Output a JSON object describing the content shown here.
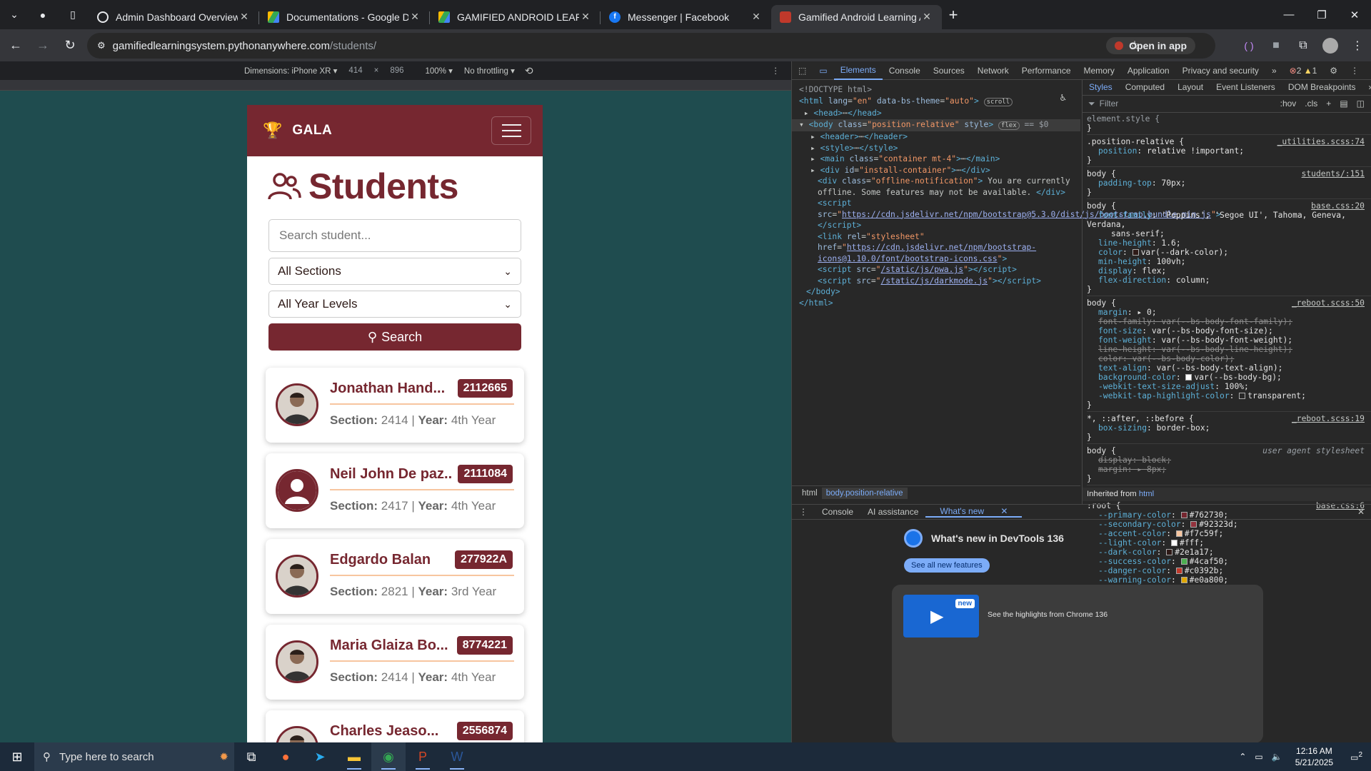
{
  "browser": {
    "tabs": [
      {
        "title": "Admin Dashboard Overview",
        "active": false
      },
      {
        "title": "Documentations - Google Drive",
        "active": false
      },
      {
        "title": "GAMIFIED ANDROID LEARNING",
        "active": false
      },
      {
        "title": "Messenger | Facebook",
        "active": false
      },
      {
        "title": "Gamified Android Learning App",
        "active": true
      }
    ],
    "url_host": "gamifiedlearningsystem.pythonanywhere.com",
    "url_path": "/students/",
    "open_in_app": "Open in app"
  },
  "device_toolbar": {
    "dimensions": "Dimensions: iPhone XR",
    "width": "414",
    "x": "×",
    "height": "896",
    "zoom": "100%",
    "throttle": "No throttling"
  },
  "page": {
    "brand": "GALA",
    "title": "Students",
    "search_placeholder": "Search student...",
    "section_filter": "All Sections",
    "year_filter": "All Year Levels",
    "search_button": "Search",
    "section_label": "Section:",
    "year_label": "Year:",
    "students": [
      {
        "name": "Jonathan Hand...",
        "id": "2112665",
        "section": "2414",
        "year": "4th Year",
        "avatar": "photo"
      },
      {
        "name": "Neil John De paz...",
        "id": "2111084",
        "section": "2417",
        "year": "4th Year",
        "avatar": "default"
      },
      {
        "name": "Edgardo Balan",
        "id": "277922A",
        "section": "2821",
        "year": "3rd Year",
        "avatar": "photo"
      },
      {
        "name": "Maria Glaiza Bo...",
        "id": "8774221",
        "section": "2414",
        "year": "4th Year",
        "avatar": "photo"
      },
      {
        "name": "Charles Jeaso...",
        "id": "2556874",
        "section": "",
        "year": "",
        "avatar": "photo"
      }
    ]
  },
  "devtools": {
    "tabs": [
      "Elements",
      "Console",
      "Sources",
      "Network",
      "Performance",
      "Memory",
      "Application",
      "Privacy and security"
    ],
    "errors": "2",
    "warnings": "1",
    "styles_tabs": [
      "Styles",
      "Computed",
      "Layout",
      "Event Listeners",
      "DOM Breakpoints"
    ],
    "filter_placeholder": "Filter",
    "hov": ":hov",
    "cls": ".cls",
    "breadcrumbs": [
      "html",
      "body.position-relative"
    ],
    "drawer_tabs": [
      "Console",
      "AI assistance",
      "What's new"
    ],
    "whats_new_title": "What's new in DevTools 136",
    "see_all": "See all new features",
    "highlight_text": "See the highlights from Chrome 136",
    "new_badge": "new"
  },
  "taskbar": {
    "search_placeholder": "Type here to search",
    "time": "12:16 AM",
    "date": "5/21/2025",
    "notifications": "2"
  },
  "colors": {
    "primary": "#762730",
    "secondary": "#92323d",
    "accent": "#f7c59f",
    "light": "#fff",
    "dark": "#2e1a17",
    "success": "#4caf50",
    "danger": "#c0392b",
    "warning": "#e0a800",
    "info": "#5bc0de"
  }
}
